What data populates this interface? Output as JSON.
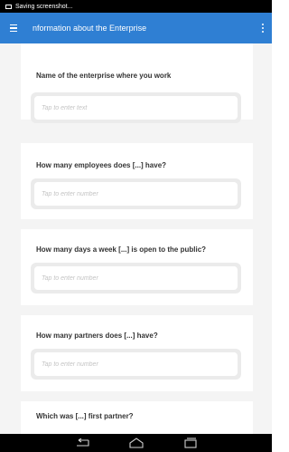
{
  "status": {
    "text": "Saving screenshot..."
  },
  "appbar": {
    "title": "nformation about the Enterprise"
  },
  "questions": [
    {
      "label": "Name of the enterprise where you work",
      "placeholder": "Tap to enter text"
    },
    {
      "label": "How many employees does [...] have?",
      "placeholder": "Tap to enter number"
    },
    {
      "label": "How many days a week [...] is open to the public?",
      "placeholder": "Tap to enter number"
    },
    {
      "label": "How many partners does [...] have?",
      "placeholder": "Tap to enter number"
    },
    {
      "label": "Which was [...] first partner?"
    }
  ],
  "icons": {
    "menu": "hamburger-icon",
    "more": "overflow-icon",
    "back": "back-icon",
    "home": "home-icon",
    "recents": "recents-icon"
  },
  "colors": {
    "appbar": "#2f7fd3",
    "background": "#f4f4f4",
    "field_frame": "#ebebeb"
  }
}
